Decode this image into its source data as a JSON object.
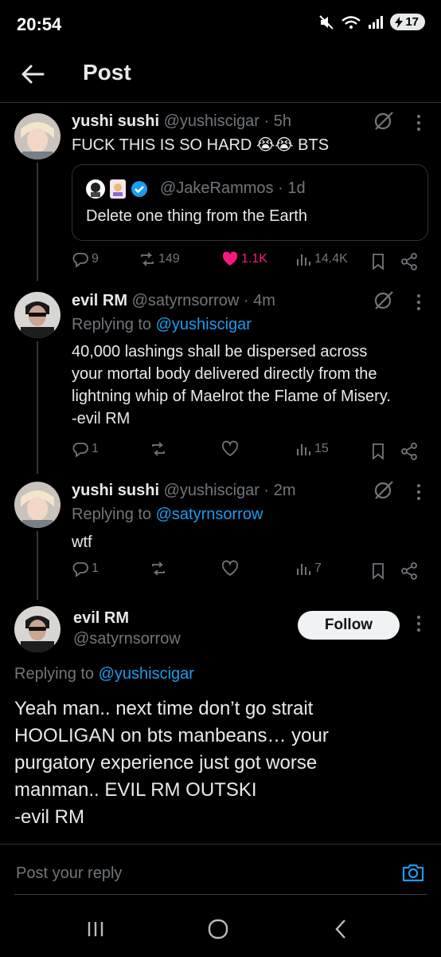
{
  "status_bar": {
    "time": "20:54",
    "battery": "17"
  },
  "header": {
    "title": "Post"
  },
  "post1": {
    "display_name": "yushi sushi",
    "meta": "@yushiscigar · 5h",
    "text": "FUCK THIS IS SO HARD 😭😭 BTS",
    "quote": {
      "user": "@JakeRammos · 1d",
      "text": "Delete one thing from the Earth"
    },
    "counts": {
      "replies": "9",
      "reposts": "149",
      "likes": "1.1K",
      "views": "14.4K"
    }
  },
  "post2": {
    "display_name": "evil RM",
    "meta": "@satyrnsorrow · 4m",
    "replying_prefix": "Replying to",
    "replying_handle": "@yushiscigar",
    "text_lines": [
      "40,000 lashings shall be dispersed across",
      "your mortal body delivered directly from the",
      "lightning whip of Maelrot the Flame of Misery.",
      "-evil RM"
    ],
    "counts": {
      "replies": "1",
      "views": "15"
    }
  },
  "post3": {
    "display_name": "yushi sushi",
    "meta": "@yushiscigar · 2m",
    "replying_prefix": "Replying to",
    "replying_handle": "@satyrnsorrow",
    "text": "wtf",
    "counts": {
      "replies": "1",
      "views": "7"
    }
  },
  "main_post": {
    "display_name": "evil RM",
    "handle": "@satyrnsorrow",
    "follow_label": "Follow",
    "replying_prefix": "Replying to",
    "replying_handle": "@yushiscigar",
    "text_lines": [
      "Yeah man.. next time don’t go strait",
      "HOOLIGAN on bts manbeans… your",
      "purgatory experience just got worse",
      "manman.. EVIL RM OUTSKI",
      "-evil RM"
    ]
  },
  "reply_bar": {
    "placeholder": "Post your reply"
  },
  "colors": {
    "accent": "#1d9bf0",
    "like": "#f91880",
    "muted": "#71767b",
    "background": "#000000"
  }
}
